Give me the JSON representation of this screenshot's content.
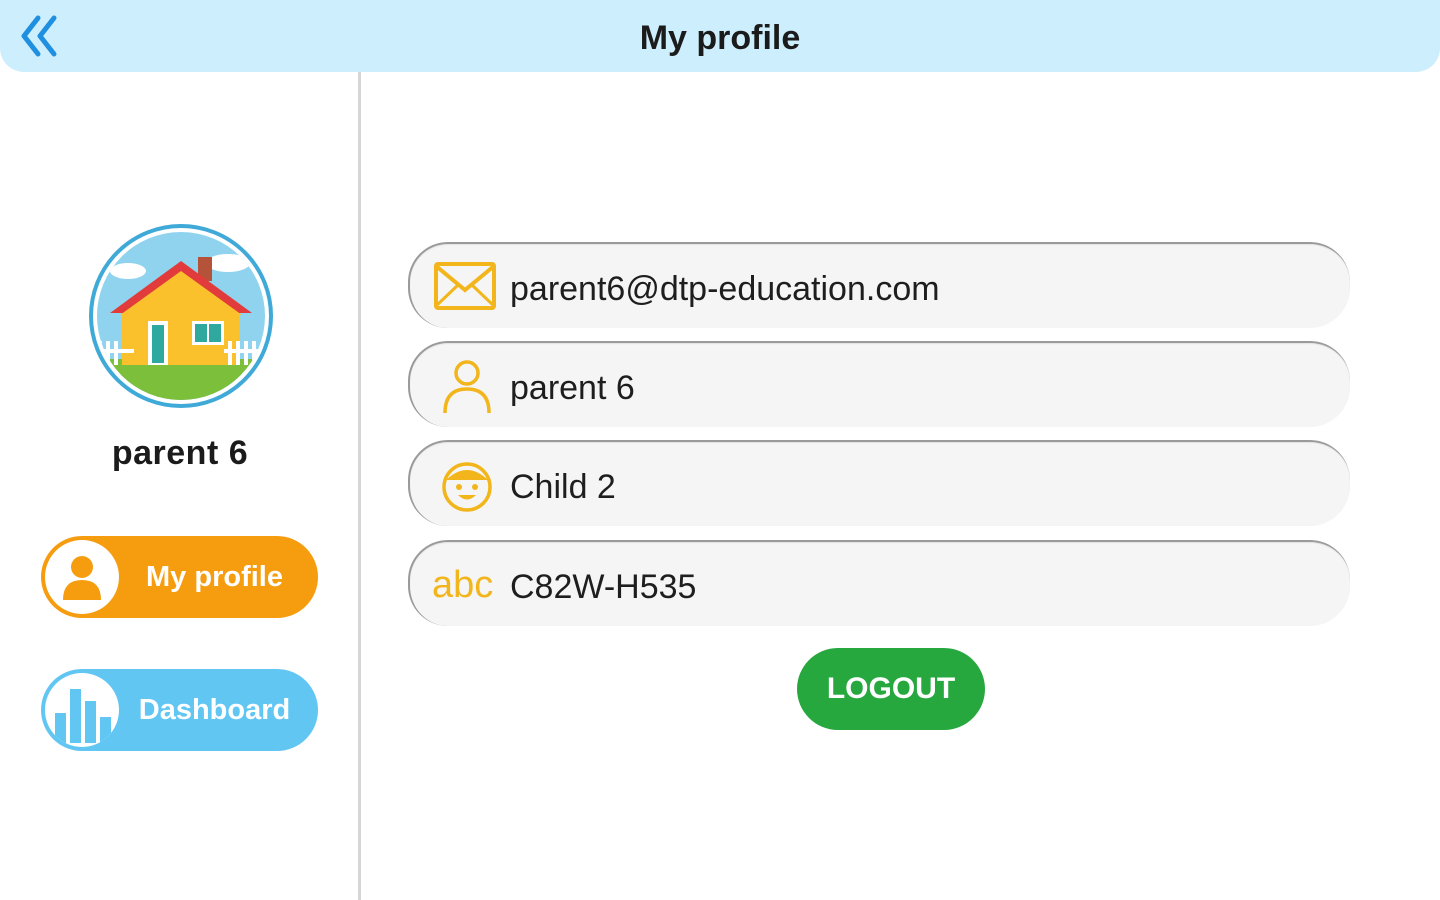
{
  "header": {
    "title": "My profile",
    "back_icon": "double-chevron-left-icon"
  },
  "profile": {
    "name": "parent 6",
    "avatar_icon": "house-avatar-icon"
  },
  "nav": {
    "my_profile": {
      "label": "My profile",
      "icon": "person-icon",
      "color": "#f59d0f"
    },
    "dashboard": {
      "label": "Dashboard",
      "icon": "bar-chart-icon",
      "color": "#62c6f3"
    }
  },
  "fields": {
    "email": {
      "value": "parent6@dtp-education.com",
      "icon": "envelope-icon"
    },
    "name": {
      "value": "parent 6",
      "icon": "person-outline-icon"
    },
    "child": {
      "value": "Child 2",
      "icon": "child-face-icon"
    },
    "code": {
      "value": "C82W-H535",
      "icon_text": "abc"
    }
  },
  "actions": {
    "logout_label": "LOGOUT",
    "logout_color": "#27a83f"
  },
  "colors": {
    "header_bg": "#cdeefc",
    "accent_yellow": "#f2b61c"
  }
}
